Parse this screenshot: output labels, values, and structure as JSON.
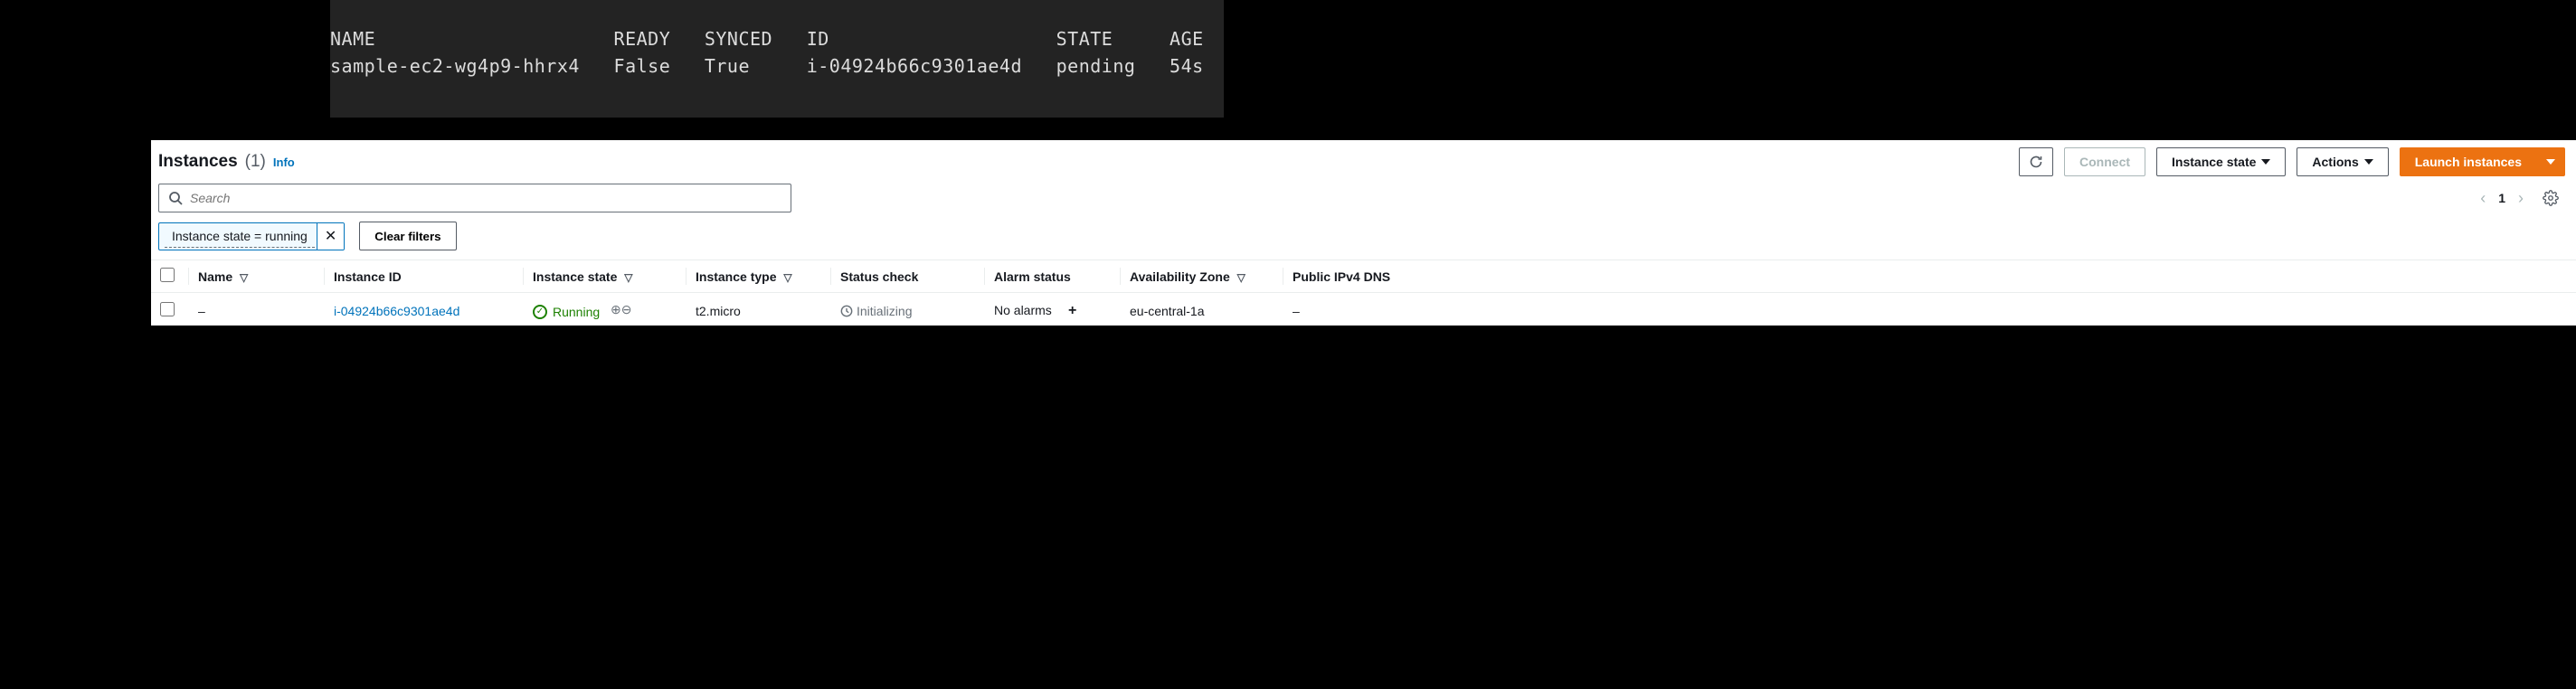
{
  "terminal": {
    "text": "NAME                     READY   SYNCED   ID                    STATE     AGE\nsample-ec2-wg4p9-hhrx4   False   True     i-04924b66c9301ae4d   pending   54s"
  },
  "console": {
    "title": "Instances",
    "count": "(1)",
    "info": "Info",
    "actions": {
      "connect": "Connect",
      "instance_state": "Instance state",
      "actions": "Actions",
      "launch": "Launch instances"
    },
    "search": {
      "placeholder": "Search"
    },
    "pagination": {
      "current": "1"
    },
    "filters": {
      "chip": "Instance state = running",
      "clear": "Clear filters"
    },
    "columns": {
      "name": "Name",
      "instance_id": "Instance ID",
      "instance_state": "Instance state",
      "instance_type": "Instance type",
      "status_check": "Status check",
      "alarm_status": "Alarm status",
      "az": "Availability Zone",
      "public_dns": "Public IPv4 DNS"
    },
    "row": {
      "name": "–",
      "instance_id": "i-04924b66c9301ae4d",
      "instance_state": "Running",
      "instance_type": "t2.micro",
      "status_check": "Initializing",
      "alarm_status": "No alarms",
      "az": "eu-central-1a",
      "public_dns": "–"
    }
  }
}
